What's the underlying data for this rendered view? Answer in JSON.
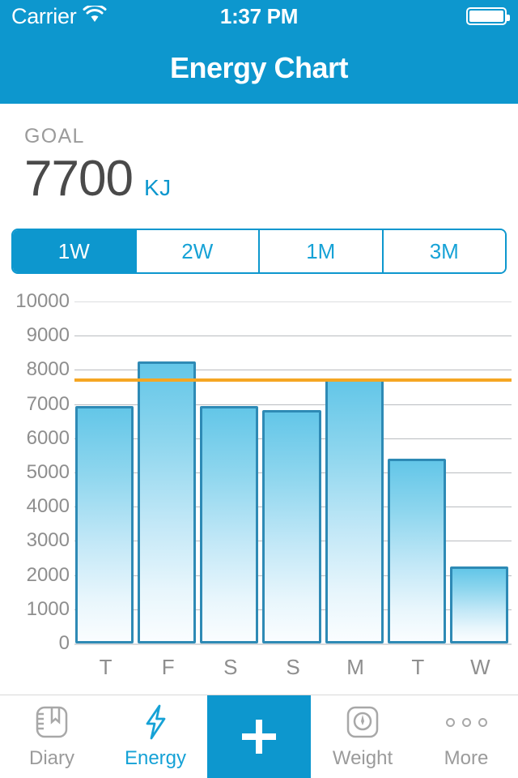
{
  "status_bar": {
    "carrier": "Carrier",
    "wifi_icon": "wifi-icon",
    "time": "1:37 PM",
    "battery_icon": "battery-full-icon"
  },
  "nav": {
    "title": "Energy Chart"
  },
  "goal": {
    "label": "GOAL",
    "value": "7700",
    "unit": "KJ"
  },
  "segmented": {
    "options": [
      {
        "label": "1W",
        "active": true
      },
      {
        "label": "2W",
        "active": false
      },
      {
        "label": "1M",
        "active": false
      },
      {
        "label": "3M",
        "active": false
      }
    ]
  },
  "colors": {
    "brand": "#0d97ce",
    "accent_text": "#16a2d6",
    "goal_line": "#f5a623",
    "bar_stroke": "#2e8ab5",
    "bar_fill_top": "#63c6e8",
    "bar_fill_bottom": "#fafdff",
    "muted_text": "#9b9b9b",
    "grid": "#b9bcc0"
  },
  "chart_data": {
    "type": "bar",
    "title": "Energy Chart",
    "xlabel": "",
    "ylabel": "",
    "categories": [
      "T",
      "F",
      "S",
      "S",
      "M",
      "T",
      "W"
    ],
    "values": [
      6950,
      8250,
      6950,
      6820,
      7750,
      5400,
      2250
    ],
    "ylim": [
      0,
      10000
    ],
    "yticks": [
      0,
      1000,
      2000,
      3000,
      4000,
      5000,
      6000,
      7000,
      8000,
      9000,
      10000
    ],
    "ytick_labels": [
      "0",
      "1000",
      "2000",
      "3000",
      "4000",
      "5000",
      "6000",
      "7000",
      "8000",
      "9000",
      "10000"
    ],
    "grid": true,
    "legend": "none",
    "annotations": [
      {
        "type": "hline",
        "name": "goal-line",
        "value": 7700,
        "color": "#f5a623",
        "label": "GOAL 7700 KJ"
      }
    ],
    "series": [
      {
        "name": "Energy (KJ)",
        "values": [
          6950,
          8250,
          6950,
          6820,
          7750,
          5400,
          2250
        ]
      }
    ]
  },
  "tabbar": {
    "items": [
      {
        "label": "Diary",
        "icon": "book-icon",
        "active": false
      },
      {
        "label": "Energy",
        "icon": "lightning-icon",
        "active": true
      },
      {
        "label": "",
        "icon": "plus-icon",
        "active": false
      },
      {
        "label": "Weight",
        "icon": "scale-icon",
        "active": false
      },
      {
        "label": "More",
        "icon": "ellipsis-icon",
        "active": false
      }
    ]
  }
}
